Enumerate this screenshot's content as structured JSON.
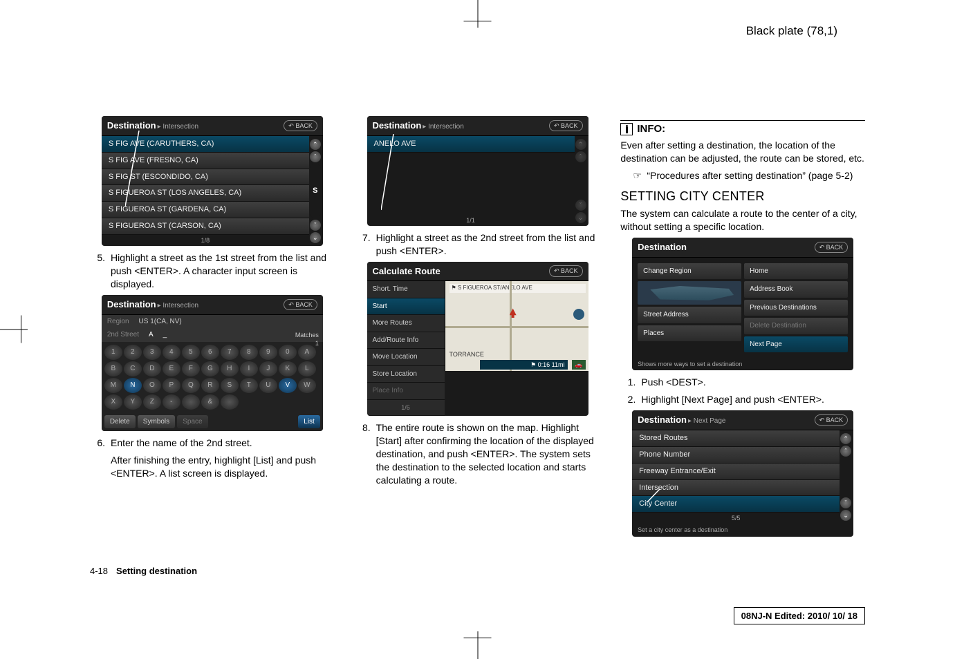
{
  "plate": "Black plate (78,1)",
  "footer": {
    "page": "4-18",
    "section": "Setting destination"
  },
  "edit_stamp": "08NJ-N Edited:  2010/ 10/ 18",
  "col1": {
    "shot1": {
      "title": "Destination",
      "subtitle": "▸ Intersection",
      "back": "BACK",
      "items": [
        "S FIG AVE (CARUTHERS, CA)",
        "S FIG AVE (FRESNO, CA)",
        "S FIG ST (ESCONDIDO, CA)",
        "S FIGUEROA ST (LOS ANGELES, CA)",
        "S FIGUEROA ST (GARDENA, CA)",
        "S FIGUEROA ST (CARSON, CA)"
      ],
      "scroll": {
        "letter": "S",
        "page": "1/8"
      }
    },
    "step5": "Highlight a street as the 1st street from the list and push <ENTER>. A character input screen is displayed.",
    "shot2": {
      "title": "Destination",
      "subtitle": "▸ Intersection",
      "back": "BACK",
      "region_label": "Region",
      "region_val": "US 1(CA, NV)",
      "street_label": "2nd Street",
      "street_val": "A",
      "matches_label": "Matches",
      "matches_val": "1",
      "keys_row1": [
        "1",
        "2",
        "3",
        "4",
        "5",
        "6",
        "7",
        "8",
        "9",
        "0"
      ],
      "keys_row2": [
        "A",
        "B",
        "C",
        "D",
        "E",
        "F",
        "G",
        "H",
        "I",
        "J"
      ],
      "keys_row3": [
        "K",
        "L",
        "M",
        "N",
        "O",
        "P",
        "Q",
        "R",
        "S",
        "T"
      ],
      "keys_row4": [
        "U",
        "V",
        "W",
        "X",
        "Y",
        "Z",
        "-",
        "",
        "&",
        ""
      ],
      "delete": "Delete",
      "symbols": "Symbols",
      "space": "Space",
      "list": "List"
    },
    "step6": "Enter the name of the 2nd street.",
    "step6b": "After finishing the entry, highlight [List] and push <ENTER>. A list screen is displayed."
  },
  "col2": {
    "shot1": {
      "title": "Destination",
      "subtitle": "▸ Intersection",
      "back": "BACK",
      "items": [
        "ANELO AVE"
      ],
      "page": "1/1"
    },
    "step7": "Highlight a street as the 2nd street from the list and push <ENTER>.",
    "shot2": {
      "title": "Calculate Route",
      "back": "BACK",
      "menu": [
        "Short. Time",
        "Start",
        "More Routes",
        "Add/Route Info",
        "Move Location",
        "Store Location",
        "Place Info"
      ],
      "map_hint": "S FIGUEROA ST/ANELO AVE",
      "corner": "TORRANCE",
      "scale": "1/6",
      "dist": "0:16   11mi"
    },
    "step8": "The entire route is shown on the map. Highlight [Start] after confirming the location of the displayed destination, and push <ENTER>. The system sets the destination to the selected location and starts calculating a route."
  },
  "col3": {
    "info_title": "INFO:",
    "info_body": "Even after setting a destination, the location of the destination can be adjusted, the route can be stored, etc.",
    "xref": "“Procedures after setting destination” (page 5-2)",
    "heading": "SETTING CITY CENTER",
    "lead": "The system can calculate a route to the center of a city, without setting a specific location.",
    "shot1": {
      "title": "Destination",
      "back": "BACK",
      "left": [
        "Change Region",
        "",
        "Street Address",
        "Places"
      ],
      "left_map": true,
      "right": [
        "Home",
        "Address Book",
        "Previous Destinations",
        "Delete Destination",
        "Next Page"
      ],
      "hint": "Shows more ways to set a destination"
    },
    "step1": "Push <DEST>.",
    "step2": "Highlight [Next Page] and push <ENTER>.",
    "shot2": {
      "title": "Destination",
      "subtitle": "▸ Next Page",
      "back": "BACK",
      "items": [
        "Stored Routes",
        "Phone Number",
        "Freeway Entrance/Exit",
        "Intersection",
        "City Center"
      ],
      "page": "5/5",
      "hint": "Set a city center as a destination"
    }
  }
}
